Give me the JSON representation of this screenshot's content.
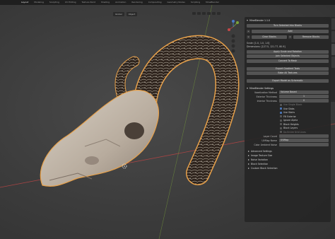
{
  "topbar": {
    "workspaces": [
      "Layout",
      "Modeling",
      "Sculpting",
      "UV Editing",
      "Texture Paint",
      "Shading",
      "Animation",
      "Rendering",
      "Compositing",
      "Geometry Nodes",
      "Scripting",
      "MineBlender"
    ],
    "active_index": 0
  },
  "viewport_header": {
    "orientation": "Global",
    "snap_label": "Object"
  },
  "panel": {
    "title": "MineBlender 1.1.0",
    "turn_selected_label": "Turn Selected Into Blocks",
    "add_label": "Add",
    "clear_blocks_label": "Clear Blocks",
    "remove_blocks_label": "Remove Blocks",
    "scale_info": "Scale: [1.0, 1.0, 1.0]",
    "dimensions_info": "Dimensions: [127.5, 121.77, 80.9]",
    "apply_scale_label": "Apply Scale and Rotation",
    "join_objects_label": "Join Selected Objects",
    "convert_mesh_label": "Convert To Mesh",
    "export_gradient_label": "Export Gradient Tools",
    "bake_textures_label": "Bake All Textures",
    "export_schematic_label": "Export Model as Schematic",
    "settings_title": "MineBlender Settings",
    "voxel_method_label": "Voxelization Method",
    "voxel_method_value": "Volume Based",
    "exterior_label": "Exterior Thickness",
    "exterior_value": "1",
    "interior_label": "Interior Thickness",
    "interior_value": "0",
    "options": [
      {
        "label": "Use Single Block",
        "on": false,
        "dim": true
      },
      {
        "label": "Use Slabs",
        "on": true,
        "dim": false
      },
      {
        "label": "Use Stairs",
        "on": true,
        "dim": false
      },
      {
        "label": "Fill Exterior",
        "on": false,
        "dim": false
      },
      {
        "label": "Ignore Alpha",
        "on": false,
        "dim": false
      },
      {
        "label": "Block Heights",
        "on": false,
        "dim": false
      },
      {
        "label": "Block Layers",
        "on": false,
        "dim": false
      },
      {
        "label": "Do Entire Grid Lines",
        "on": false,
        "dim": true
      }
    ],
    "layer_count_label": "Layer Count",
    "layer_count_value": "",
    "uv_map_label": "UVMap Name",
    "uv_map_value": "UVMap",
    "color_ambient_label": "Color Ambient Noise",
    "color_ambient_value": "",
    "subpanels": [
      "Advanced Settings",
      "Image Texture Size",
      "Noise Variation",
      "Block Selection",
      "Custom Block Selection"
    ]
  },
  "colors": {
    "selection_outline": "#e8a14a",
    "skull": "#c9bfb2",
    "horn": "#3a2c22",
    "checkbox_on": "#4772b3",
    "x_axis": "#a84444",
    "y_axis": "#7aa33a"
  },
  "icons": {
    "gizmo": "navigation-gizmo-icon",
    "cursor": "3d-cursor-icon",
    "add": "plus-icon",
    "remove": "x-icon"
  }
}
